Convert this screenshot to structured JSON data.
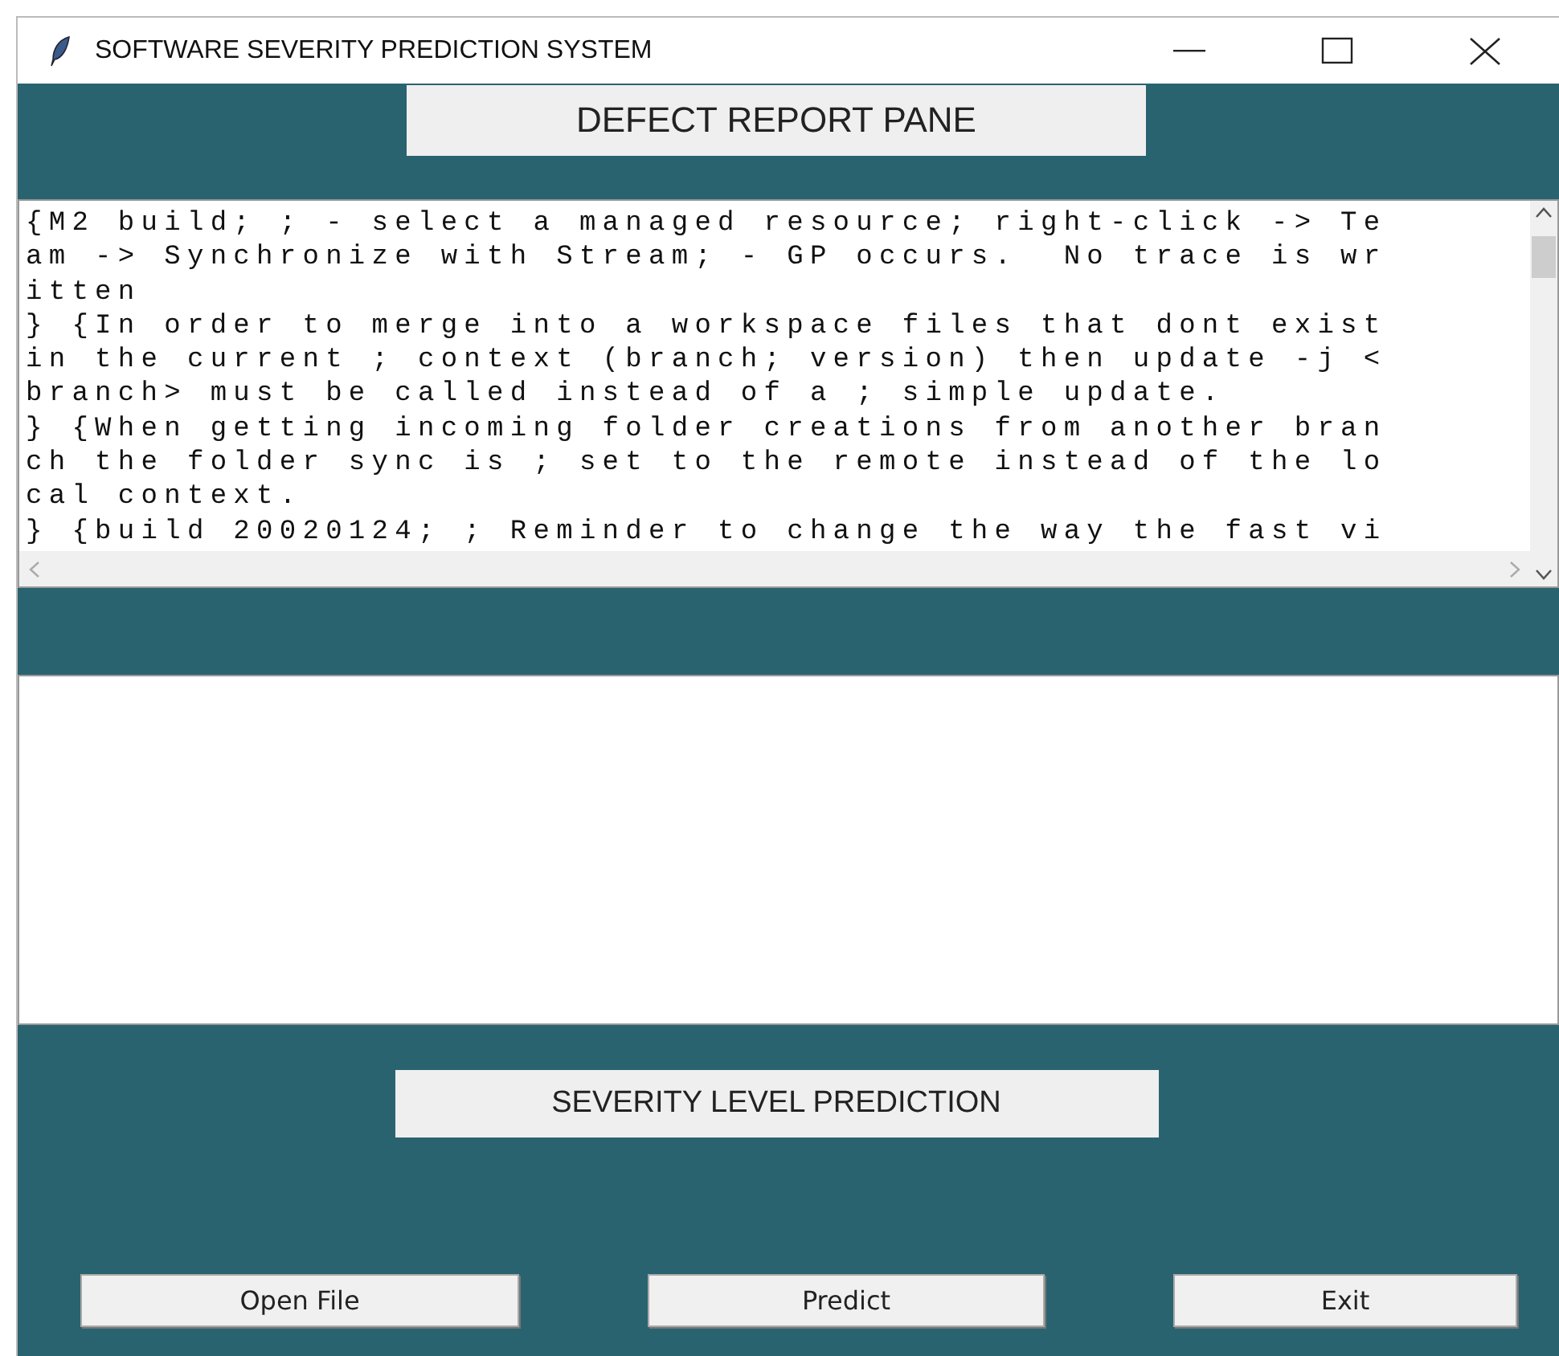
{
  "window": {
    "title": "SOFTWARE SEVERITY PREDICTION SYSTEM"
  },
  "heading": "DEFECT REPORT PANE",
  "report_text": {
    "lines": [
      "{M2 build; ; - select a managed resource; right-click -> Te",
      "am -> Synchronize with Stream; - GP occurs.  No trace is wr",
      "itten",
      "} {In order to merge into a workspace files that dont exist",
      "in the current ; context (branch; version) then update -j <",
      "branch> must be called instead of a ; simple update.",
      "} {When getting incoming folder creations from another bran",
      "ch the folder sync is ; set to the remote instead of the lo",
      "cal context.",
      "} {build 20020124; ; Reminder to change the way the fast vi"
    ]
  },
  "prediction_label": "SEVERITY LEVEL PREDICTION",
  "buttons": [
    {
      "label": "Open File"
    },
    {
      "label": "Predict"
    },
    {
      "label": "Exit"
    }
  ]
}
